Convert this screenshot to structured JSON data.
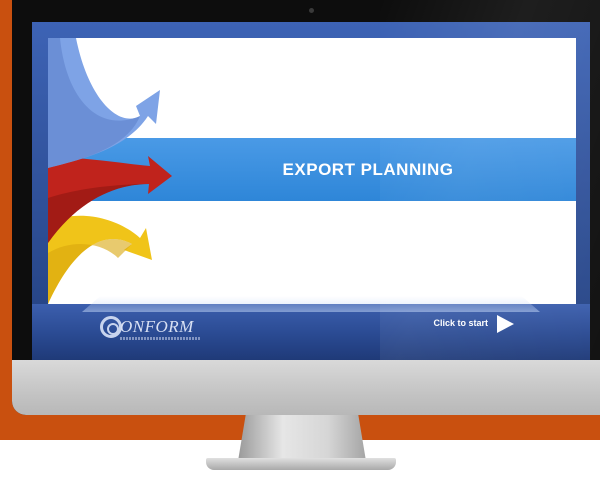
{
  "slide": {
    "title": "EXPORT PLANNING"
  },
  "player": {
    "start_label": "Click to start"
  },
  "logo": {
    "text": "ONFORM"
  },
  "icons": {
    "play": "play-icon",
    "arrows": "arrows-graphic",
    "logo": "conform-logo"
  },
  "colors": {
    "backdrop": "#c9500f",
    "title_bar": "#2e86d8",
    "player_bar": "#2a4a92",
    "arrow_blue": "#7ea3e6",
    "arrow_red": "#c0231c",
    "arrow_yellow": "#f0c419"
  }
}
